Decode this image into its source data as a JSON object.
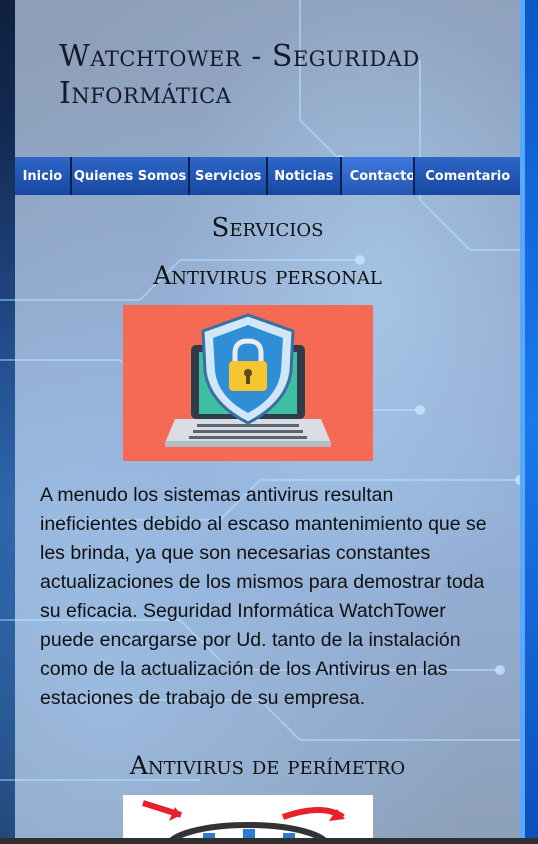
{
  "site": {
    "title": "Watchtower - Seguridad Informática"
  },
  "nav": {
    "items": [
      {
        "label": "Inicio"
      },
      {
        "label": "Quienes Somos"
      },
      {
        "label": "Servicios"
      },
      {
        "label": "Noticias"
      },
      {
        "label": "Contacto"
      },
      {
        "label": "Comentario"
      }
    ]
  },
  "content": {
    "heading": "Servicios",
    "section1": {
      "title": "Antivirus personal",
      "image_icon": "laptop-shield-lock-icon",
      "paragraph": "A menudo los sistemas antivirus resultan ineficientes debido al escaso mantenimiento que se les brinda, ya que son necesarias constantes actualizaciones de los mismos para demostrar toda su eficacia. Seguridad Informática WatchTower puede encargarse por Ud. tanto de la instalación como de la actualización de los Antivirus en las estaciones de trabajo de su empresa."
    },
    "section2": {
      "title": "Antivirus de perímetro",
      "image_icon": "network-perimeter-icon"
    }
  },
  "colors": {
    "nav_bg": "#1e4fa6",
    "image1_bg": "#f46a55",
    "accent_right": "#1b79ea"
  }
}
